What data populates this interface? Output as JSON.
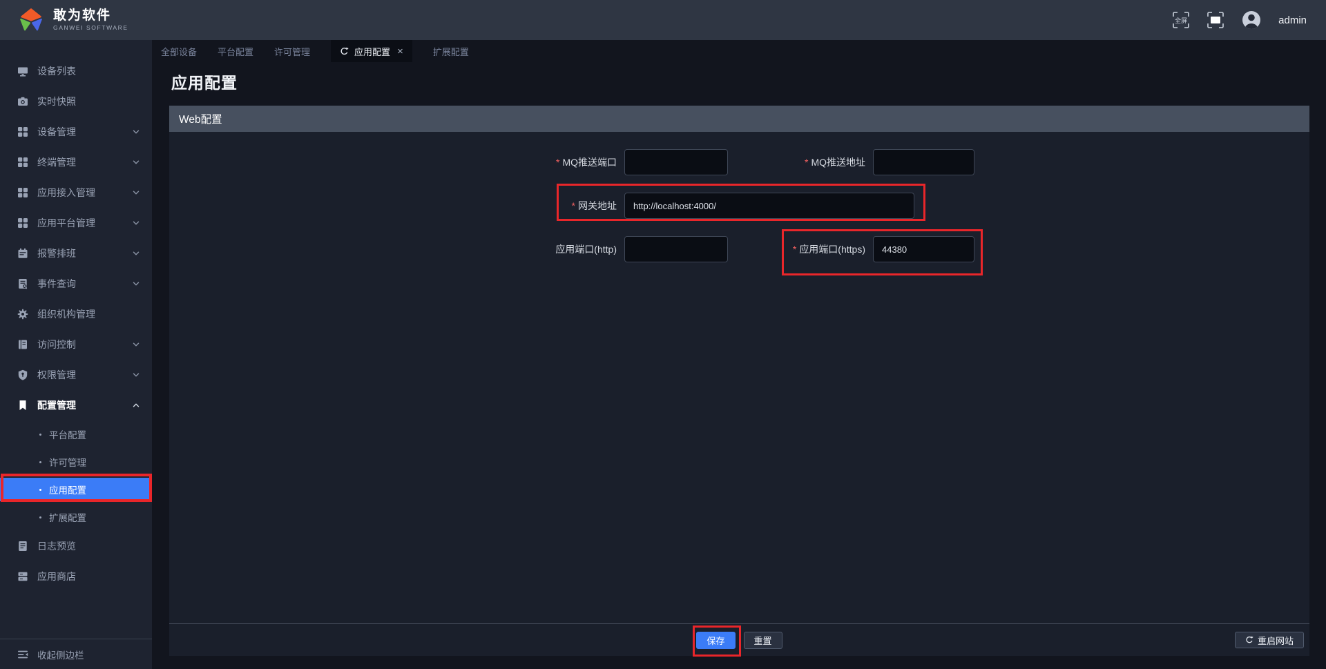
{
  "colors": {
    "accent_blue": "#3b7cf7",
    "annotation_red": "#e9262a"
  },
  "header": {
    "brand_title": "敢为软件",
    "brand_subtitle": "GANWEI SOFTWARE",
    "fullscreen_label": "全屏",
    "username": "admin"
  },
  "tabs": [
    {
      "name": "tab-all-devices",
      "label": "全部设备",
      "active": false
    },
    {
      "name": "tab-platform-config",
      "label": "平台配置",
      "active": false
    },
    {
      "name": "tab-license-mgmt",
      "label": "许可管理",
      "active": false
    },
    {
      "name": "tab-app-config",
      "label": "应用配置",
      "active": true,
      "close_glyph": "×"
    },
    {
      "name": "tab-extension-config",
      "label": "扩展配置",
      "active": false
    }
  ],
  "sidebar": {
    "items": [
      {
        "name": "device-list",
        "label": "设备列表",
        "icon": "monitor"
      },
      {
        "name": "live-snapshot",
        "label": "实时快照",
        "icon": "camera"
      },
      {
        "name": "device-mgmt",
        "label": "设备管理",
        "icon": "grid",
        "chevron": "down"
      },
      {
        "name": "terminal-mgmt",
        "label": "终端管理",
        "icon": "grid",
        "chevron": "down"
      },
      {
        "name": "app-access-mgmt",
        "label": "应用接入管理",
        "icon": "grid",
        "chevron": "down"
      },
      {
        "name": "app-platform-mgmt",
        "label": "应用平台管理",
        "icon": "grid",
        "chevron": "down"
      },
      {
        "name": "alarm-schedule",
        "label": "报警排班",
        "icon": "calendar",
        "chevron": "down"
      },
      {
        "name": "event-query",
        "label": "事件查询",
        "icon": "event",
        "chevron": "down"
      },
      {
        "name": "org-mgmt",
        "label": "组织机构管理",
        "icon": "gear"
      },
      {
        "name": "access-control",
        "label": "访问控制",
        "icon": "book",
        "chevron": "down"
      },
      {
        "name": "permission-mgmt",
        "label": "权限管理",
        "icon": "shield",
        "chevron": "down"
      },
      {
        "name": "config-mgmt",
        "label": "配置管理",
        "icon": "bookmark",
        "chevron": "up",
        "expanded": true,
        "children": [
          {
            "name": "platform-config",
            "label": "平台配置",
            "active": false
          },
          {
            "name": "license-mgmt",
            "label": "许可管理",
            "active": false
          },
          {
            "name": "app-config",
            "label": "应用配置",
            "active": true
          },
          {
            "name": "extension-config",
            "label": "扩展配置",
            "active": false
          }
        ]
      },
      {
        "name": "log-preview",
        "label": "日志预览",
        "icon": "log"
      },
      {
        "name": "app-store",
        "label": "应用商店",
        "icon": "store"
      }
    ],
    "collapse_label": "收起侧边栏"
  },
  "page": {
    "title": "应用配置",
    "section_title": "Web配置"
  },
  "form": {
    "fields": [
      {
        "name": "mq-push-port",
        "label": "MQ推送端口",
        "required": true,
        "value": ""
      },
      {
        "name": "mq-push-address",
        "label": "MQ推送地址",
        "required": true,
        "value": ""
      },
      {
        "name": "gateway-address",
        "label": "网关地址",
        "required": true,
        "value": "http://localhost:4000/"
      },
      {
        "name": "app-port-http",
        "label": "应用端口(http)",
        "required": false,
        "value": ""
      },
      {
        "name": "app-port-https",
        "label": "应用端口(https)",
        "required": true,
        "value": "44380"
      }
    ]
  },
  "footer": {
    "save_label": "保存",
    "reset_label": "重置",
    "restart_label": "重启网站"
  }
}
